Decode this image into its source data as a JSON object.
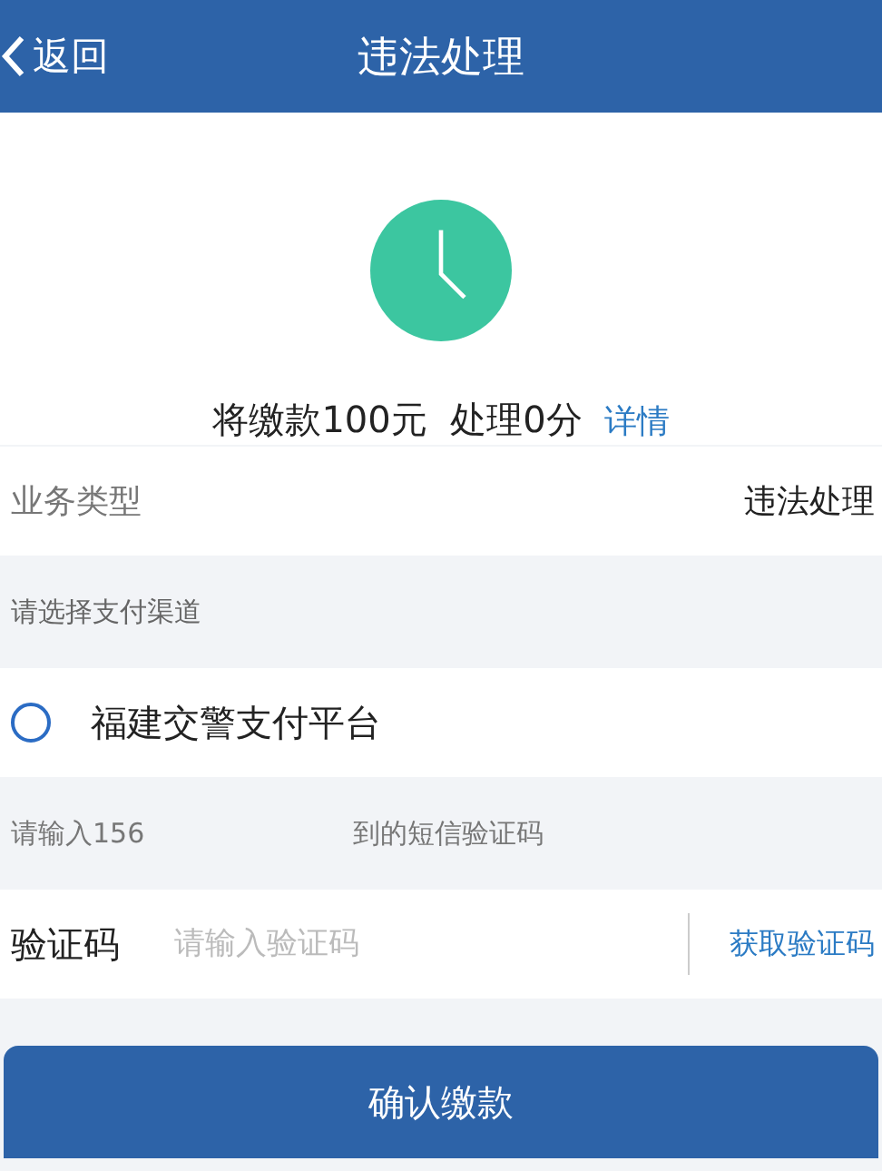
{
  "header": {
    "back": "返回",
    "title": "违法处理"
  },
  "summary": {
    "text": "将缴款100元  处理0分",
    "link": "详情"
  },
  "business": {
    "label": "业务类型",
    "value": "违法处理"
  },
  "payment": {
    "heading": "请选择支付渠道",
    "channels": [
      {
        "name": "福建交警支付平台",
        "selected": false
      }
    ]
  },
  "sms": {
    "hint_start": "请输入156",
    "hint_end": "到的短信验证码",
    "label": "验证码",
    "placeholder": "请输入验证码",
    "get_code": "获取验证码"
  },
  "confirm": "确认缴款"
}
